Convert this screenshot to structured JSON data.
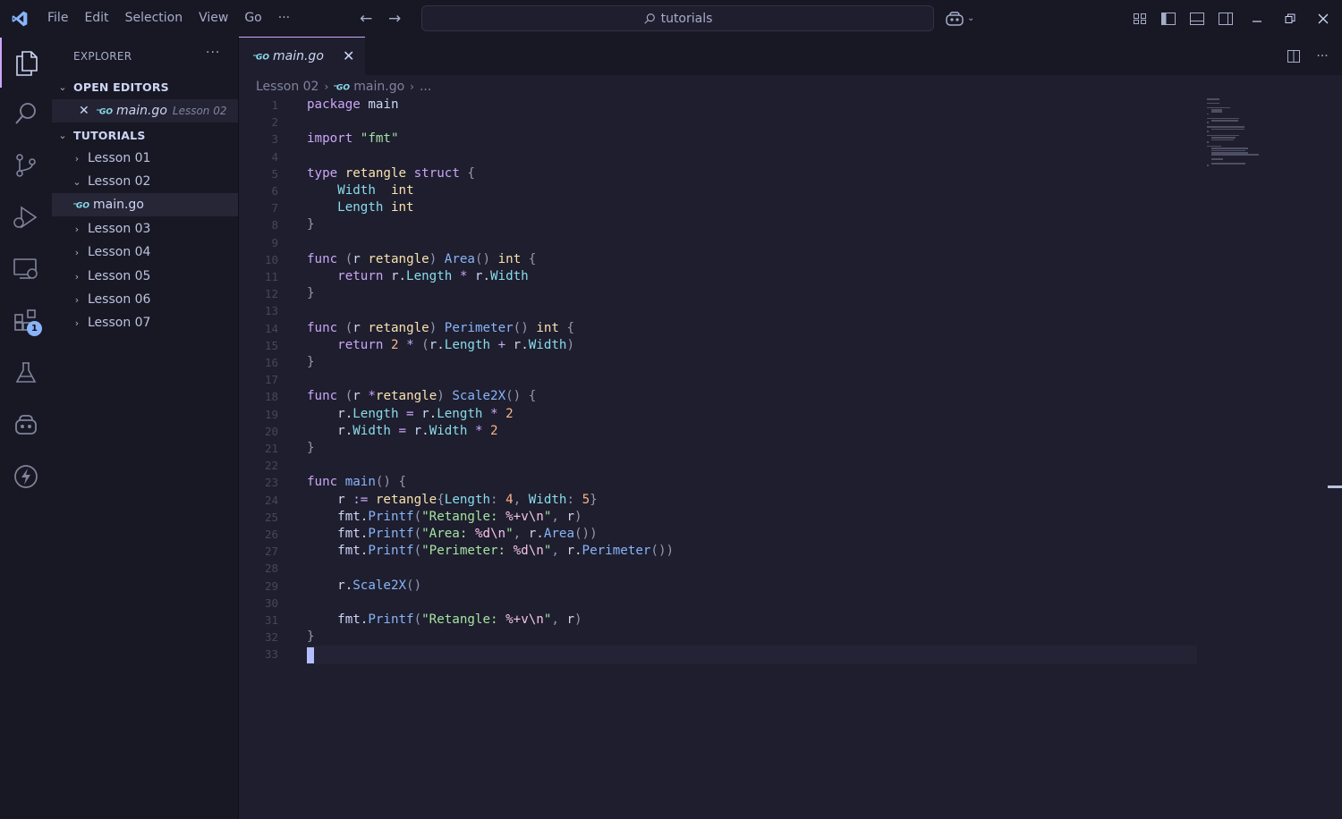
{
  "menu": [
    "File",
    "Edit",
    "Selection",
    "View",
    "Go"
  ],
  "menu_more": "···",
  "search": {
    "text": "tutorials"
  },
  "explorer": {
    "title": "EXPLORER",
    "more": "···",
    "open_editors": {
      "label": "OPEN EDITORS",
      "items": [
        {
          "name": "main.go",
          "description": "Lesson 02"
        }
      ]
    },
    "folder": {
      "label": "TUTORIALS",
      "items": [
        {
          "label": "Lesson 01",
          "expanded": false
        },
        {
          "label": "Lesson 02",
          "expanded": true
        },
        {
          "label": "main.go",
          "file": true
        },
        {
          "label": "Lesson 03",
          "expanded": false
        },
        {
          "label": "Lesson 04",
          "expanded": false
        },
        {
          "label": "Lesson 05",
          "expanded": false
        },
        {
          "label": "Lesson 06",
          "expanded": false
        },
        {
          "label": "Lesson 07",
          "expanded": false
        }
      ]
    }
  },
  "activity_bar": {
    "items": [
      "files-icon",
      "search-icon",
      "source-control-icon",
      "run-debug-icon",
      "remote-explorer-icon",
      "extensions-icon",
      "testing-icon",
      "copilot-icon",
      "thunder-client-icon"
    ],
    "extensions_badge": "1"
  },
  "tab": {
    "label": "main.go",
    "close": "✕"
  },
  "breadcrumb": {
    "folder": "Lesson 02",
    "file": "main.go",
    "more": "..."
  },
  "colors": {
    "accent": "#cba6f7",
    "background": "#1e1e2e",
    "sidebar": "#181825"
  },
  "code": {
    "language": "go",
    "lines": [
      [
        [
          "k",
          "package"
        ],
        [
          "v",
          " main"
        ]
      ],
      [],
      [
        [
          "k",
          "import"
        ],
        [
          "v",
          " "
        ],
        [
          "s",
          "\"fmt\""
        ]
      ],
      [],
      [
        [
          "k",
          "type"
        ],
        [
          "v",
          " "
        ],
        [
          "t",
          "retangle"
        ],
        [
          "v",
          " "
        ],
        [
          "k",
          "struct"
        ],
        [
          "v",
          " "
        ],
        [
          "p",
          "{"
        ]
      ],
      [
        [
          "v",
          "    "
        ],
        [
          "pr",
          "Width"
        ],
        [
          "v",
          "  "
        ],
        [
          "t",
          "int"
        ]
      ],
      [
        [
          "v",
          "    "
        ],
        [
          "pr",
          "Length"
        ],
        [
          "v",
          " "
        ],
        [
          "t",
          "int"
        ]
      ],
      [
        [
          "p",
          "}"
        ]
      ],
      [],
      [
        [
          "k",
          "func"
        ],
        [
          "v",
          " "
        ],
        [
          "p",
          "("
        ],
        [
          "v",
          "r "
        ],
        [
          "t",
          "retangle"
        ],
        [
          "p",
          ")"
        ],
        [
          "v",
          " "
        ],
        [
          "f",
          "Area"
        ],
        [
          "p",
          "()"
        ],
        [
          "v",
          " "
        ],
        [
          "t",
          "int"
        ],
        [
          "v",
          " "
        ],
        [
          "p",
          "{"
        ]
      ],
      [
        [
          "v",
          "    "
        ],
        [
          "k",
          "return"
        ],
        [
          "v",
          " r."
        ],
        [
          "pr",
          "Length"
        ],
        [
          "v",
          " "
        ],
        [
          "k",
          "*"
        ],
        [
          "v",
          " r."
        ],
        [
          "pr",
          "Width"
        ]
      ],
      [
        [
          "p",
          "}"
        ]
      ],
      [],
      [
        [
          "k",
          "func"
        ],
        [
          "v",
          " "
        ],
        [
          "p",
          "("
        ],
        [
          "v",
          "r "
        ],
        [
          "t",
          "retangle"
        ],
        [
          "p",
          ")"
        ],
        [
          "v",
          " "
        ],
        [
          "f",
          "Perimeter"
        ],
        [
          "p",
          "()"
        ],
        [
          "v",
          " "
        ],
        [
          "t",
          "int"
        ],
        [
          "v",
          " "
        ],
        [
          "p",
          "{"
        ]
      ],
      [
        [
          "v",
          "    "
        ],
        [
          "k",
          "return"
        ],
        [
          "v",
          " "
        ],
        [
          "n",
          "2"
        ],
        [
          "v",
          " "
        ],
        [
          "k",
          "*"
        ],
        [
          "v",
          " "
        ],
        [
          "p",
          "("
        ],
        [
          "v",
          "r."
        ],
        [
          "pr",
          "Length"
        ],
        [
          "v",
          " "
        ],
        [
          "k",
          "+"
        ],
        [
          "v",
          " r."
        ],
        [
          "pr",
          "Width"
        ],
        [
          "p",
          ")"
        ]
      ],
      [
        [
          "p",
          "}"
        ]
      ],
      [],
      [
        [
          "k",
          "func"
        ],
        [
          "v",
          " "
        ],
        [
          "p",
          "("
        ],
        [
          "v",
          "r "
        ],
        [
          "k",
          "*"
        ],
        [
          "t",
          "retangle"
        ],
        [
          "p",
          ")"
        ],
        [
          "v",
          " "
        ],
        [
          "f",
          "Scale2X"
        ],
        [
          "p",
          "()"
        ],
        [
          "v",
          " "
        ],
        [
          "p",
          "{"
        ]
      ],
      [
        [
          "v",
          "    r."
        ],
        [
          "pr",
          "Length"
        ],
        [
          "v",
          " "
        ],
        [
          "k",
          "="
        ],
        [
          "v",
          " r."
        ],
        [
          "pr",
          "Length"
        ],
        [
          "v",
          " "
        ],
        [
          "k",
          "*"
        ],
        [
          "v",
          " "
        ],
        [
          "n",
          "2"
        ]
      ],
      [
        [
          "v",
          "    r."
        ],
        [
          "pr",
          "Width"
        ],
        [
          "v",
          " "
        ],
        [
          "k",
          "="
        ],
        [
          "v",
          " r."
        ],
        [
          "pr",
          "Width"
        ],
        [
          "v",
          " "
        ],
        [
          "k",
          "*"
        ],
        [
          "v",
          " "
        ],
        [
          "n",
          "2"
        ]
      ],
      [
        [
          "p",
          "}"
        ]
      ],
      [],
      [
        [
          "k",
          "func"
        ],
        [
          "v",
          " "
        ],
        [
          "f",
          "main"
        ],
        [
          "p",
          "()"
        ],
        [
          "v",
          " "
        ],
        [
          "p",
          "{"
        ]
      ],
      [
        [
          "v",
          "    r "
        ],
        [
          "k",
          ":="
        ],
        [
          "v",
          " "
        ],
        [
          "t",
          "retangle"
        ],
        [
          "p",
          "{"
        ],
        [
          "pr",
          "Length"
        ],
        [
          "p",
          ":"
        ],
        [
          "v",
          " "
        ],
        [
          "n",
          "4"
        ],
        [
          "p",
          ","
        ],
        [
          "v",
          " "
        ],
        [
          "pr",
          "Width"
        ],
        [
          "p",
          ":"
        ],
        [
          "v",
          " "
        ],
        [
          "n",
          "5"
        ],
        [
          "p",
          "}"
        ]
      ],
      [
        [
          "v",
          "    fmt."
        ],
        [
          "f",
          "Printf"
        ],
        [
          "p",
          "("
        ],
        [
          "s",
          "\"Retangle: "
        ],
        [
          "esc",
          "%+v\\n"
        ],
        [
          "s",
          "\""
        ],
        [
          "p",
          ","
        ],
        [
          "v",
          " r"
        ],
        [
          "p",
          ")"
        ]
      ],
      [
        [
          "v",
          "    fmt."
        ],
        [
          "f",
          "Printf"
        ],
        [
          "p",
          "("
        ],
        [
          "s",
          "\"Area: "
        ],
        [
          "esc",
          "%d\\n"
        ],
        [
          "s",
          "\""
        ],
        [
          "p",
          ","
        ],
        [
          "v",
          " r."
        ],
        [
          "f",
          "Area"
        ],
        [
          "p",
          "())"
        ]
      ],
      [
        [
          "v",
          "    fmt."
        ],
        [
          "f",
          "Printf"
        ],
        [
          "p",
          "("
        ],
        [
          "s",
          "\"Perimeter: "
        ],
        [
          "esc",
          "%d\\n"
        ],
        [
          "s",
          "\""
        ],
        [
          "p",
          ","
        ],
        [
          "v",
          " r."
        ],
        [
          "f",
          "Perimeter"
        ],
        [
          "p",
          "())"
        ]
      ],
      [],
      [
        [
          "v",
          "    r."
        ],
        [
          "f",
          "Scale2X"
        ],
        [
          "p",
          "()"
        ]
      ],
      [],
      [
        [
          "v",
          "    fmt."
        ],
        [
          "f",
          "Printf"
        ],
        [
          "p",
          "("
        ],
        [
          "s",
          "\"Retangle: "
        ],
        [
          "esc",
          "%+v\\n"
        ],
        [
          "s",
          "\""
        ],
        [
          "p",
          ","
        ],
        [
          "v",
          " r"
        ],
        [
          "p",
          ")"
        ]
      ],
      [
        [
          "p",
          "}"
        ]
      ],
      []
    ]
  }
}
